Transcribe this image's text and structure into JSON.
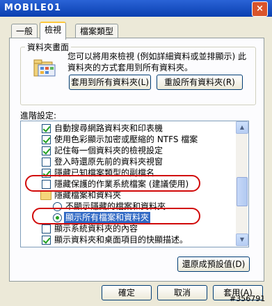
{
  "window": {
    "title_fragment": "MOBILE01",
    "close_label": "×"
  },
  "tabs": [
    {
      "label": "一般",
      "active": false
    },
    {
      "label": "檢視",
      "active": true
    },
    {
      "label": "檔案類型",
      "active": false
    }
  ],
  "folder_views": {
    "group_title": "資料夾畫面",
    "description_line1": "您可以將用來檢視 (例如詳細資料或並排顯示) 此",
    "description_line2": "資料夾的方式套用到所有資料夾。",
    "apply_all_label": "套用到所有資料夾(L)",
    "reset_all_label": "重設所有資料夾(R)"
  },
  "advanced": {
    "label": "進階設定:",
    "items": [
      {
        "kind": "checkbox",
        "checked": true,
        "label": "自動搜尋網路資料夾和印表機"
      },
      {
        "kind": "checkbox",
        "checked": true,
        "label": "使用色彩顯示加密或壓縮的 NTFS 檔案"
      },
      {
        "kind": "checkbox",
        "checked": true,
        "label": "記住每一個資料夾的檢視設定"
      },
      {
        "kind": "checkbox",
        "checked": false,
        "label": "登入時還原先前的資料夾視窗"
      },
      {
        "kind": "checkbox",
        "checked": true,
        "label": "隱藏已知檔案類型的副檔名"
      },
      {
        "kind": "checkbox",
        "checked": false,
        "label": "隱藏保護的作業系統檔案 (建議使用)"
      },
      {
        "kind": "folder",
        "checked": false,
        "label": "隱藏檔案和資料夾"
      },
      {
        "kind": "radio",
        "checked": false,
        "label": "不顯示隱藏的檔案和資料夾"
      },
      {
        "kind": "radio",
        "checked": true,
        "label": "顯示所有檔案和資料夾"
      },
      {
        "kind": "checkbox",
        "checked": false,
        "label": "顯示系統資料夾的內容"
      },
      {
        "kind": "checkbox",
        "checked": true,
        "label": "顯示資料夾和桌面項目的快顯描述。"
      }
    ],
    "restore_defaults_label": "還原成預設值(D)"
  },
  "footer": {
    "ok_label": "確定",
    "cancel_label": "取消",
    "apply_label": "套用(A)"
  },
  "watermark": "#356791",
  "colors": {
    "annotation_red": "#d10a0a",
    "selection_blue": "#316ac5",
    "check_green": "#21a121"
  }
}
